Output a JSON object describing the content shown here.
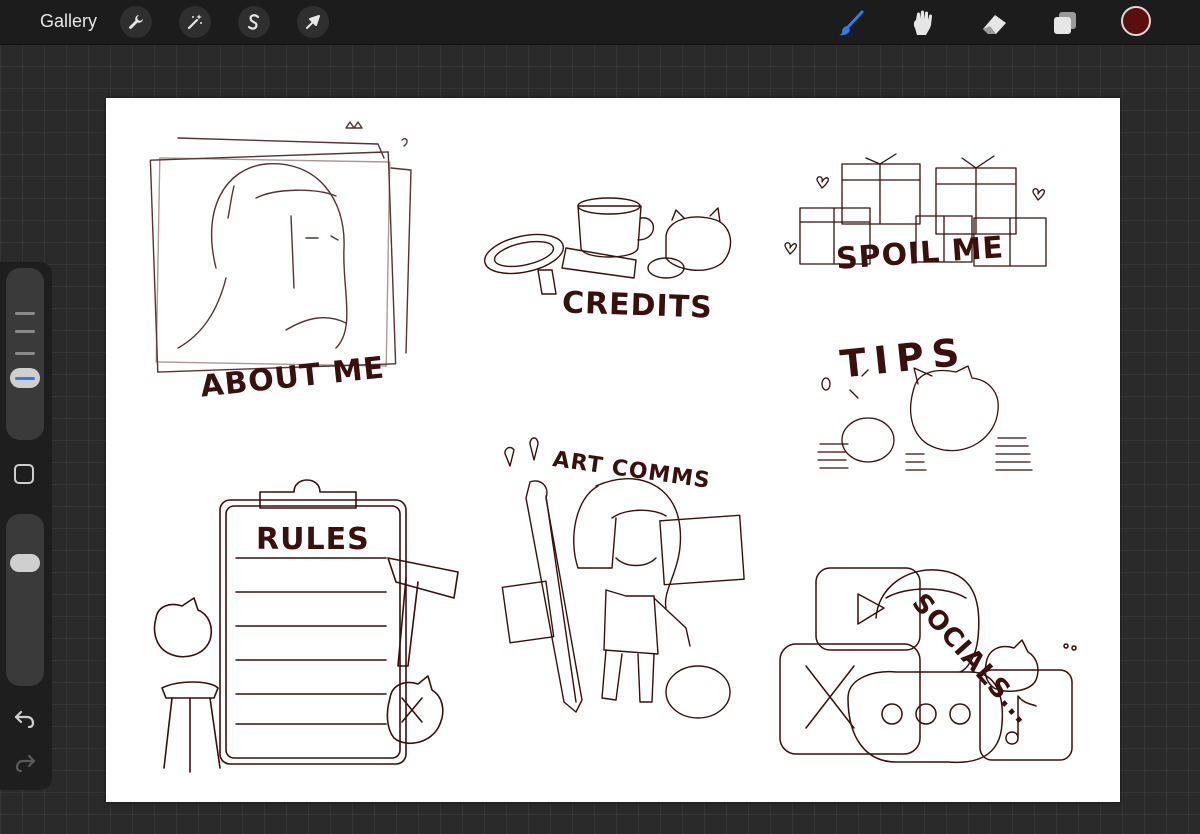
{
  "toolbar": {
    "gallery_label": "Gallery",
    "left_tools": [
      "wrench-icon",
      "magic-wand-icon",
      "selection-s-icon",
      "transform-arrow-icon"
    ],
    "right_tools": [
      "brush-icon",
      "smudge-icon",
      "eraser-icon",
      "layers-icon"
    ],
    "active_tool": "brush-icon",
    "accent_color": "#2f7bf0",
    "current_color": "#5a0f0c"
  },
  "sidebar": {
    "brush_size_level": 0.62,
    "opacity_level": 0.3,
    "controls": [
      "size-slider",
      "modify-button",
      "opacity-slider",
      "undo-icon",
      "redo-icon"
    ]
  },
  "canvas": {
    "background": "#ffffff",
    "ink_color": "#3a0f0c",
    "labels": {
      "about_me": "ABOUT ME",
      "credits": "CREDITS",
      "spoil_me": "SPOIL ME",
      "tips": "TIPS",
      "rules": "RULES",
      "art_comms": "ART COMMS",
      "socials": "SOCIALS..."
    }
  }
}
